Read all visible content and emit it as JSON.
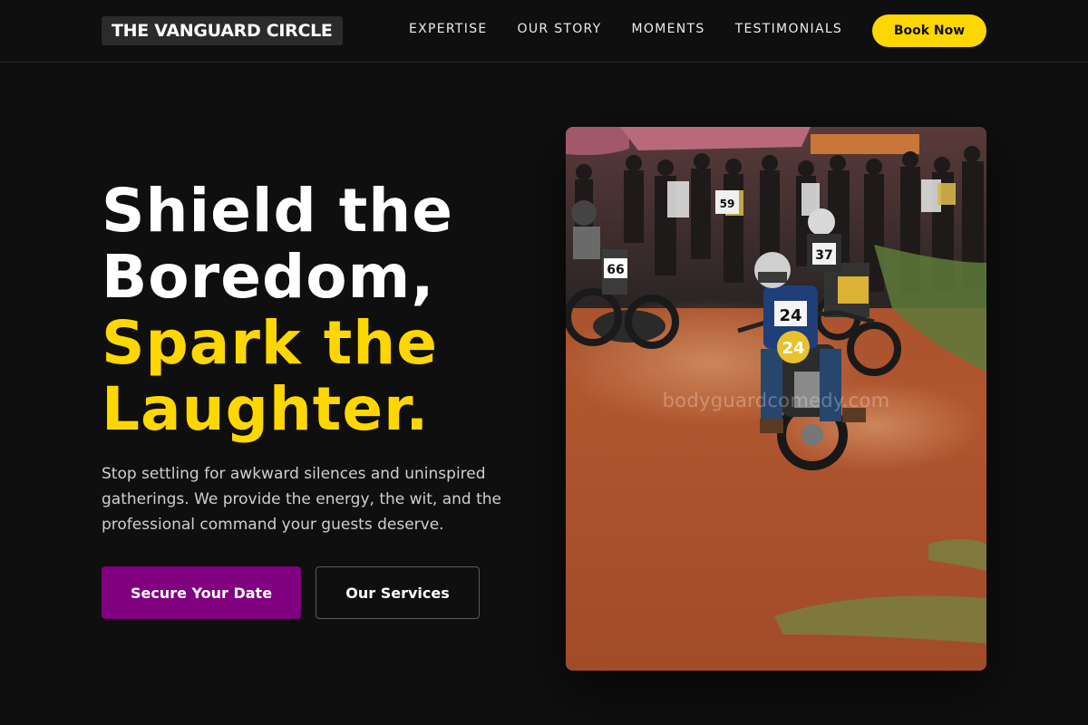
{
  "header": {
    "logo": "THE VANGUARD CIRCLE",
    "nav": [
      {
        "label": "EXPERTISE"
      },
      {
        "label": "OUR STORY"
      },
      {
        "label": "MOMENTS"
      },
      {
        "label": "TESTIMONIALS"
      }
    ],
    "cta_label": "Book Now"
  },
  "hero": {
    "headline": {
      "line1": "Shield the",
      "line2": "Boredom,",
      "line3": "Spark the",
      "line4": "Laughter."
    },
    "description": "Stop settling for awkward silences and uninspired gatherings. We provide the energy, the wit, and the professional command your guests deserve.",
    "primary_button": "Secure Your Date",
    "secondary_button": "Our Services",
    "image": {
      "watermark": "bodyguardcomedy.com",
      "rider_numbers": [
        "24",
        "37",
        "66",
        "59"
      ]
    }
  },
  "colors": {
    "background": "#0f0f0f",
    "accent_yellow": "#ffd700",
    "accent_purple": "#800080",
    "text_muted": "#cfcfcf"
  }
}
